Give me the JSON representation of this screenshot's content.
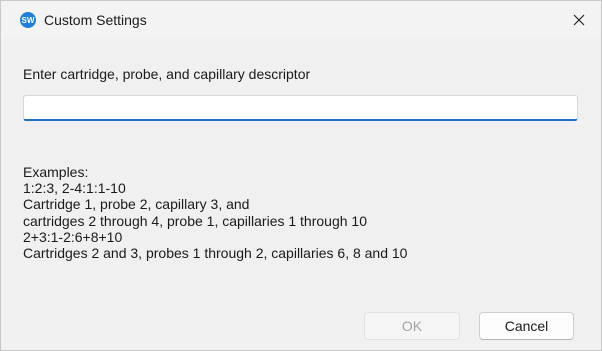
{
  "window": {
    "title": "Custom Settings",
    "app_icon": "sw-logo-icon",
    "close_icon": "close-icon",
    "close_glyph": "✕"
  },
  "form": {
    "prompt": "Enter cartridge, probe, and capillary descriptor",
    "input_value": "",
    "input_placeholder": ""
  },
  "examples": {
    "heading": "Examples:",
    "lines": [
      "1:2:3, 2-4:1:1-10",
      "Cartridge 1, probe 2, capillary 3, and",
      "cartridges 2 through 4, probe 1, capillaries 1 through 10",
      "2+3:1-2:6+8+10",
      "Cartridges 2 and 3, probes 1 through 2, capillaries 6, 8 and 10"
    ]
  },
  "buttons": {
    "ok_label": "OK",
    "ok_enabled": false,
    "cancel_label": "Cancel"
  },
  "colors": {
    "input_focus_underline": "#1f6fc5",
    "app_icon_bg": "#1f7fd6",
    "disabled_text": "#a3a3a3"
  }
}
